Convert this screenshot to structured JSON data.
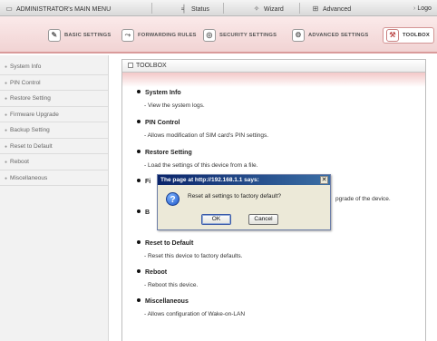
{
  "topbar": {
    "menu_label": "ADMINISTRATOR's MAIN MENU",
    "status_label": "Status",
    "wizard_label": "Wizard",
    "advanced_label": "Advanced",
    "logout_label": "Logo"
  },
  "tabs": [
    {
      "label": "BASIC SETTINGS"
    },
    {
      "label": "FORWARDING RULES"
    },
    {
      "label": "SECURITY SETTINGS"
    },
    {
      "label": "ADVANCED SETTINGS"
    },
    {
      "label": "TOOLBOX"
    }
  ],
  "sidebar": {
    "items": [
      {
        "label": "System Info"
      },
      {
        "label": "PIN Control"
      },
      {
        "label": "Restore Setting"
      },
      {
        "label": "Firmware Upgrade"
      },
      {
        "label": "Backup Setting"
      },
      {
        "label": "Reset to Default"
      },
      {
        "label": "Reboot"
      },
      {
        "label": "Miscellaneous"
      }
    ]
  },
  "panel": {
    "title": "TOOLBOX",
    "entries": [
      {
        "title": "System Info",
        "desc": "- View the system logs."
      },
      {
        "title": "PIN Control",
        "desc": "- Allows modification of SIM card's PIN settings."
      },
      {
        "title": "Restore Setting",
        "desc": "- Load the settings of this device from a file."
      },
      {
        "title": "Fi",
        "desc": "pgrade of the device."
      },
      {
        "title": "B",
        "desc": ""
      },
      {
        "title": "Reset to Default",
        "desc": "- Reset this device to factory defaults."
      },
      {
        "title": "Reboot",
        "desc": "- Reboot this device."
      },
      {
        "title": "Miscellaneous",
        "desc": "- Allows configuration of Wake-on-LAN"
      }
    ]
  },
  "dialog": {
    "title": "The page at http://192.168.1.1 says:",
    "message": "Reset all settings to factory default?",
    "ok_label": "OK",
    "cancel_label": "Cancel",
    "close_label": "✕"
  }
}
